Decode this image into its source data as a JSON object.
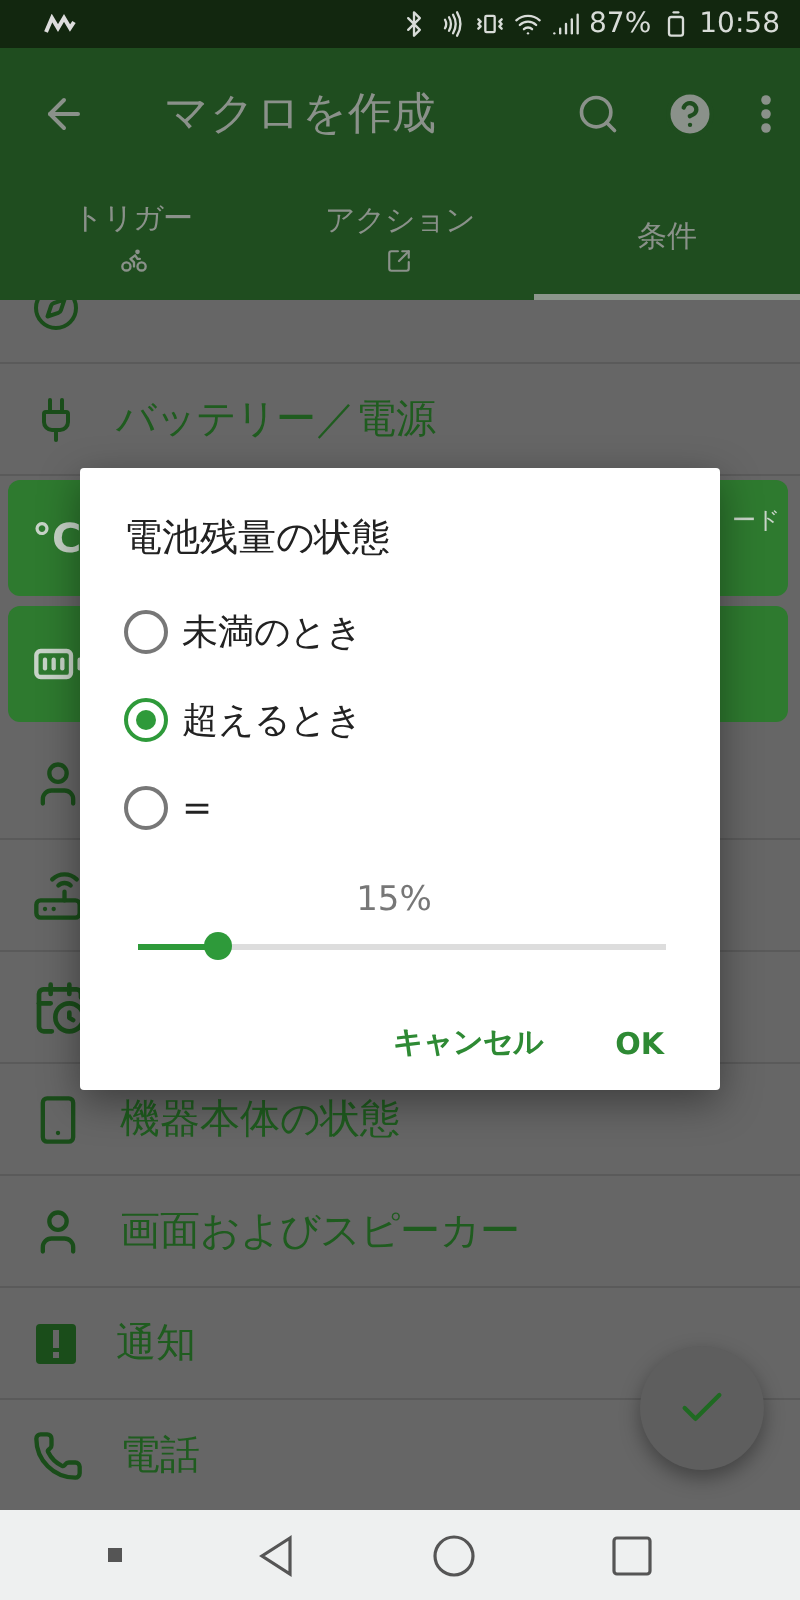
{
  "status_bar": {
    "battery": "87%",
    "time": "10:58"
  },
  "app_bar": {
    "title": "マクロを作成"
  },
  "tabs": [
    {
      "label": "トリガー",
      "selected": false
    },
    {
      "label": "アクション",
      "selected": false
    },
    {
      "label": "条件",
      "selected": true
    }
  ],
  "list": [
    {
      "kind": "row"
    },
    {
      "kind": "row",
      "label": "バッテリー／電源"
    },
    {
      "kind": "card",
      "icon_text": "°C",
      "label": "ード"
    },
    {
      "kind": "card"
    },
    {
      "kind": "row"
    },
    {
      "kind": "row"
    },
    {
      "kind": "row"
    },
    {
      "kind": "row",
      "label": "機器本体の状態"
    },
    {
      "kind": "row",
      "label": "画面およびスピーカー"
    },
    {
      "kind": "row",
      "label": "通知"
    },
    {
      "kind": "row",
      "label": "電話"
    }
  ],
  "dialog": {
    "title": "電池残量の状態",
    "options": [
      {
        "label": "未満のとき",
        "selected": false
      },
      {
        "label": "超えるとき",
        "selected": true
      },
      {
        "label": "=",
        "selected": false
      }
    ],
    "slider": {
      "reading": "15%",
      "level": 0.15
    },
    "buttons": [
      {
        "label": "キャンセル"
      },
      {
        "label": "OK"
      }
    ]
  }
}
